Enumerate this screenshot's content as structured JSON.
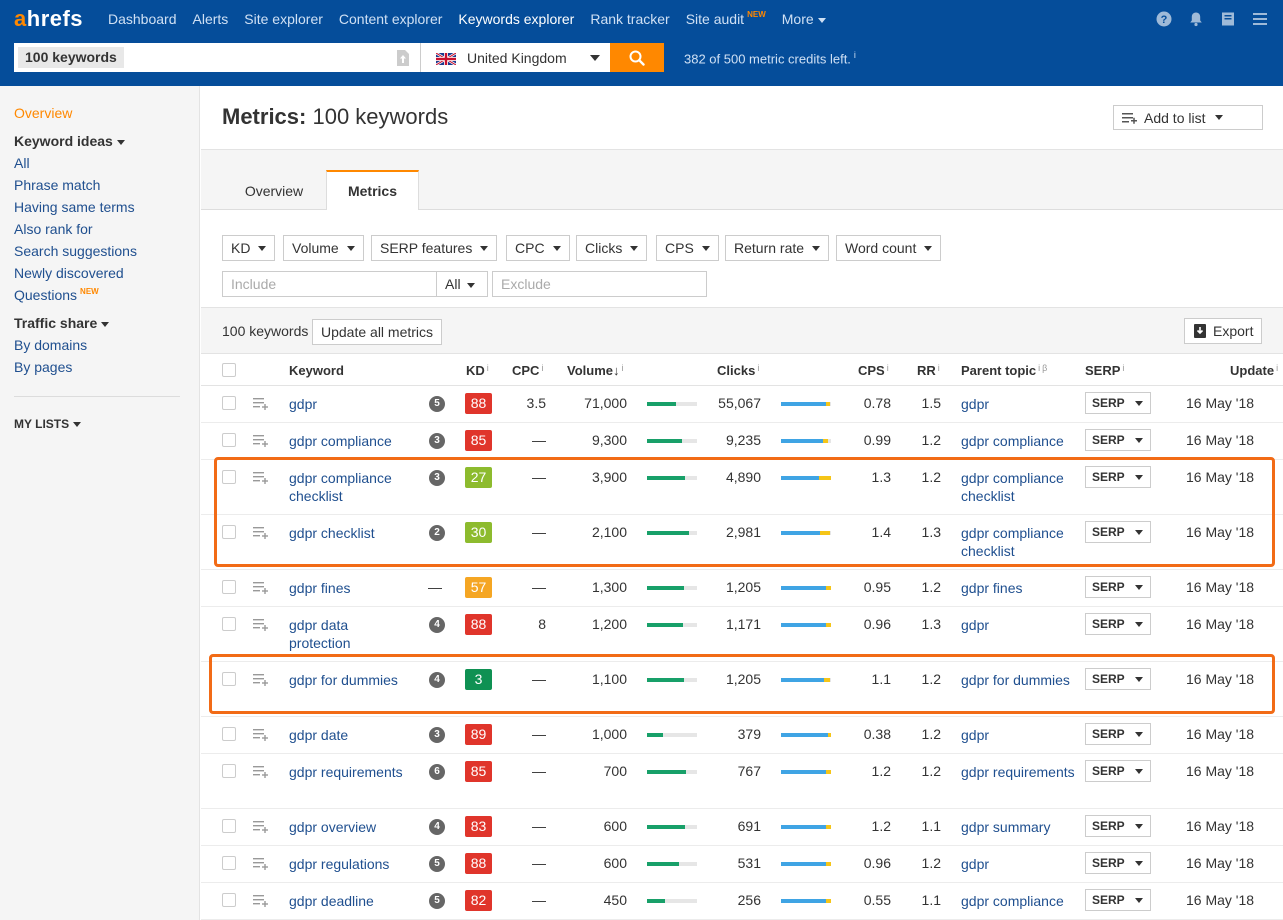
{
  "app": {
    "logo_a": "a",
    "logo_rest": "hrefs",
    "nav": [
      {
        "label": "Dashboard"
      },
      {
        "label": "Alerts"
      },
      {
        "label": "Site explorer"
      },
      {
        "label": "Content explorer"
      },
      {
        "label": "Keywords explorer",
        "active": true
      },
      {
        "label": "Rank tracker"
      },
      {
        "label": "Site audit",
        "badge": "NEW"
      },
      {
        "label": "More"
      }
    ],
    "search_chip": "100 keywords",
    "country": "United Kingdom",
    "credits": "382 of 500 metric credits left.",
    "credits_info": "i"
  },
  "sidebar": {
    "overview": "Overview",
    "keyword_ideas": "Keyword ideas",
    "ideas": [
      "All",
      "Phrase match",
      "Having same terms",
      "Also rank for",
      "Search suggestions",
      "Newly discovered",
      "Questions"
    ],
    "questions_badge": "NEW",
    "traffic_share": "Traffic share",
    "traffic": [
      "By domains",
      "By pages"
    ],
    "my_lists": "MY LISTS"
  },
  "header": {
    "title_bold": "Metrics:",
    "title_rest": " 100 keywords",
    "add_to_list": "Add to list"
  },
  "tabs": [
    "Overview",
    "Metrics"
  ],
  "filters": {
    "buttons": [
      "KD",
      "Volume",
      "SERP features",
      "CPC",
      "Clicks",
      "CPS",
      "Return rate",
      "Word count"
    ],
    "include_placeholder": "Include",
    "all_label": "All",
    "exclude_placeholder": "Exclude"
  },
  "toolbar": {
    "count": "100 keywords",
    "update": "Update all metrics",
    "export": "Export"
  },
  "columns": {
    "keyword": "Keyword",
    "kd": "KD",
    "cpc": "CPC",
    "volume": "Volume",
    "clicks": "Clicks",
    "cps": "CPS",
    "rr": "RR",
    "parent": "Parent topic",
    "serp": "SERP",
    "update": "Update",
    "info": "i",
    "beta": "β",
    "sort_arrow": "↓"
  },
  "serp_label": "SERP",
  "colors": {
    "kd_red": "#e0352b",
    "kd_green_light": "#8dbb2e",
    "kd_orange": "#f5a623",
    "kd_green_dark": "#0f9153",
    "highlight": "#f26b16",
    "brand_blue": "#054d9a",
    "brand_orange": "#ff8800"
  },
  "rows": [
    {
      "keyword": "gdpr",
      "pos": "5",
      "kd": "88",
      "kd_color": "#e0352b",
      "cpc": "3.5",
      "volume": "71,000",
      "vol_fill": 0.58,
      "clicks": "55,067",
      "clk_blue": 0.9,
      "clk_yel": 0.08,
      "cps": "0.78",
      "rr": "1.5",
      "parent": "gdpr",
      "updated": "16 May '18"
    },
    {
      "keyword": "gdpr compliance",
      "pos": "3",
      "kd": "85",
      "kd_color": "#e0352b",
      "cpc": "—",
      "volume": "9,300",
      "vol_fill": 0.7,
      "clicks": "9,235",
      "clk_blue": 0.84,
      "clk_yel": 0.1,
      "cps": "0.99",
      "rr": "1.2",
      "parent": "gdpr compliance",
      "updated": "16 May '18"
    },
    {
      "keyword": "gdpr compliance checklist",
      "pos": "3",
      "kd": "27",
      "kd_color": "#8dbb2e",
      "cpc": "—",
      "volume": "3,900",
      "vol_fill": 0.76,
      "clicks": "4,890",
      "clk_blue": 0.76,
      "clk_yel": 0.24,
      "cps": "1.3",
      "rr": "1.2",
      "parent": "gdpr compliance checklist",
      "updated": "16 May '18"
    },
    {
      "keyword": "gdpr checklist",
      "pos": "2",
      "kd": "30",
      "kd_color": "#8dbb2e",
      "cpc": "—",
      "volume": "2,100",
      "vol_fill": 0.84,
      "clicks": "2,981",
      "clk_blue": 0.78,
      "clk_yel": 0.2,
      "cps": "1.4",
      "rr": "1.3",
      "parent": "gdpr compliance checklist",
      "updated": "16 May '18"
    },
    {
      "keyword": "gdpr fines",
      "pos": "—",
      "kd": "57",
      "kd_color": "#f5a623",
      "cpc": "—",
      "volume": "1,300",
      "vol_fill": 0.74,
      "clicks": "1,205",
      "clk_blue": 0.9,
      "clk_yel": 0.1,
      "cps": "0.95",
      "rr": "1.2",
      "parent": "gdpr fines",
      "updated": "16 May '18"
    },
    {
      "keyword": "gdpr data protection",
      "pos": "4",
      "kd": "88",
      "kd_color": "#e0352b",
      "cpc": "8",
      "volume": "1,200",
      "vol_fill": 0.72,
      "clicks": "1,171",
      "clk_blue": 0.9,
      "clk_yel": 0.1,
      "cps": "0.96",
      "rr": "1.3",
      "parent": "gdpr",
      "updated": "16 May '18"
    },
    {
      "keyword": "gdpr for dummies",
      "pos": "4",
      "kd": "3",
      "kd_color": "#0f9153",
      "cpc": "—",
      "volume": "1,100",
      "vol_fill": 0.74,
      "clicks": "1,205",
      "clk_blue": 0.86,
      "clk_yel": 0.12,
      "cps": "1.1",
      "rr": "1.2",
      "parent": "gdpr for dummies",
      "updated": "16 May '18"
    },
    {
      "keyword": "gdpr date",
      "pos": "3",
      "kd": "89",
      "kd_color": "#e0352b",
      "cpc": "—",
      "volume": "1,000",
      "vol_fill": 0.32,
      "clicks": "379",
      "clk_blue": 0.94,
      "clk_yel": 0.06,
      "cps": "0.38",
      "rr": "1.2",
      "parent": "gdpr",
      "updated": "16 May '18"
    },
    {
      "keyword": "gdpr requirements",
      "pos": "6",
      "kd": "85",
      "kd_color": "#e0352b",
      "cpc": "—",
      "volume": "700",
      "vol_fill": 0.78,
      "clicks": "767",
      "clk_blue": 0.9,
      "clk_yel": 0.1,
      "cps": "1.2",
      "rr": "1.2",
      "parent": "gdpr requirements",
      "updated": "16 May '18"
    },
    {
      "keyword": "gdpr overview",
      "pos": "4",
      "kd": "83",
      "kd_color": "#e0352b",
      "cpc": "—",
      "volume": "600",
      "vol_fill": 0.76,
      "clicks": "691",
      "clk_blue": 0.9,
      "clk_yel": 0.1,
      "cps": "1.2",
      "rr": "1.1",
      "parent": "gdpr summary",
      "updated": "16 May '18"
    },
    {
      "keyword": "gdpr regulations",
      "pos": "5",
      "kd": "88",
      "kd_color": "#e0352b",
      "cpc": "—",
      "volume": "600",
      "vol_fill": 0.64,
      "clicks": "531",
      "clk_blue": 0.9,
      "clk_yel": 0.1,
      "cps": "0.96",
      "rr": "1.2",
      "parent": "gdpr",
      "updated": "16 May '18"
    },
    {
      "keyword": "gdpr deadline",
      "pos": "5",
      "kd": "82",
      "kd_color": "#e0352b",
      "cpc": "—",
      "volume": "450",
      "vol_fill": 0.36,
      "clicks": "256",
      "clk_blue": 0.9,
      "clk_yel": 0.1,
      "cps": "0.55",
      "rr": "1.1",
      "parent": "gdpr compliance",
      "updated": "16 May '18"
    }
  ]
}
